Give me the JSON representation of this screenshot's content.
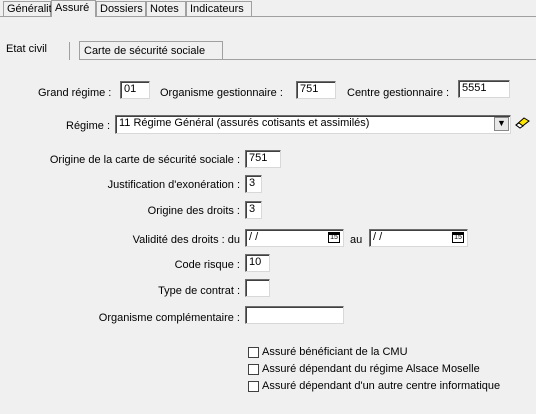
{
  "tabs": [
    "Généralités",
    "Assuré",
    "Dossiers",
    "Notes",
    "Indicateurs"
  ],
  "subtabs": [
    "Etat civil",
    "Carte de sécurité sociale"
  ],
  "grand_regime": {
    "label": "Grand régime :",
    "value": "01"
  },
  "organisme_gestionnaire": {
    "label": "Organisme gestionnaire :",
    "value": "751"
  },
  "centre_gestionnaire": {
    "label": "Centre gestionnaire :",
    "value": "5551"
  },
  "regime": {
    "label": "Régime :",
    "value": "11 Régime Général (assurés cotisants et assimilés)"
  },
  "origine_carte": {
    "label": "Origine de la carte de sécurité sociale :",
    "value": "751"
  },
  "justification": {
    "label": "Justification d'exonération :",
    "value": "3"
  },
  "origine_droits": {
    "label": "Origine des droits :",
    "value": "3"
  },
  "validite": {
    "label": "Validité des droits : du",
    "from": "/ /",
    "au_label": "au",
    "to": "/ /",
    "cal_text": "15"
  },
  "code_risque": {
    "label": "Code risque :",
    "value": "10"
  },
  "type_contrat": {
    "label": "Type de contrat :",
    "value": ""
  },
  "organisme_complementaire": {
    "label": "Organisme complémentaire :",
    "value": ""
  },
  "checkboxes": [
    {
      "label": "Assuré bénéficiant de la CMU",
      "checked": false
    },
    {
      "label": "Assuré dépendant du régime Alsace Moselle",
      "checked": false
    },
    {
      "label": "Assuré dépendant d'un autre centre informatique",
      "checked": false
    }
  ],
  "icons": {
    "dropdown": "chevron-down-icon",
    "eraser": "eraser-icon",
    "calendar": "calendar-icon"
  }
}
